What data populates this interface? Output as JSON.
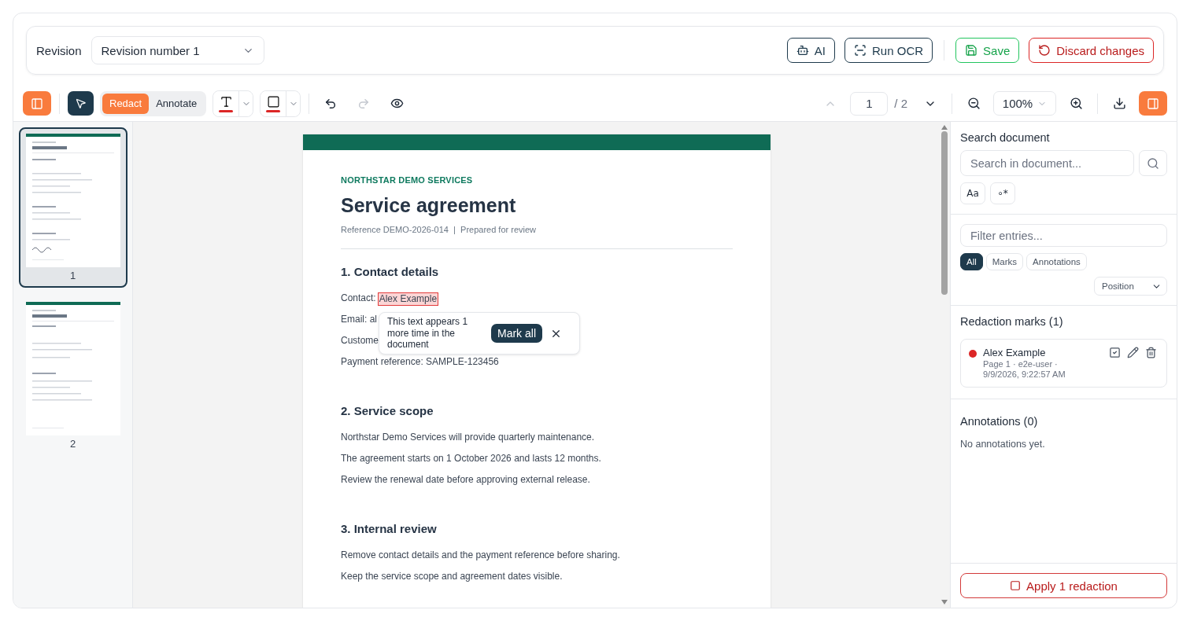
{
  "header": {
    "revision_label": "Revision",
    "revision_select": "Revision number 1",
    "buttons": [
      {
        "kind": "ai",
        "label": "AI"
      },
      {
        "kind": "ocr",
        "label": "Run OCR"
      },
      {
        "kind": "save",
        "label": "Save"
      },
      {
        "kind": "discard",
        "label": "Discard changes"
      }
    ]
  },
  "toolbar": {
    "mode_tabs": [
      {
        "label": "Redact",
        "selected": true
      },
      {
        "label": "Annotate",
        "selected": false
      }
    ],
    "tools": [
      {
        "kind": "text",
        "color": "#dc2626"
      },
      {
        "kind": "rect",
        "color": "#dc2626"
      }
    ],
    "history": [
      {
        "kind": "undo",
        "disabled": false
      },
      {
        "kind": "redo",
        "disabled": true
      }
    ],
    "page_input": "1",
    "page_total": "/ 2",
    "prev_disabled": true,
    "zoom": "100%"
  },
  "thumbnails": [
    {
      "label": "1",
      "selected": true
    },
    {
      "label": "2",
      "selected": false
    }
  ],
  "document": {
    "company": "NORTHSTAR DEMO SERVICES",
    "title": "Service agreement",
    "reference": "Reference DEMO-2026-014  |  Prepared for review",
    "sections": [
      {
        "heading": "1. Contact details",
        "lines": [
          {
            "text": "Contact:",
            "marked_text": "Alex Example"
          },
          {
            "text": "Email: al"
          },
          {
            "text": "Custome"
          },
          {
            "text": "Payment reference: SAMPLE-123456"
          }
        ]
      },
      {
        "heading": "2. Service scope",
        "lines": [
          {
            "text": "Northstar Demo Services will provide quarterly maintenance."
          },
          {
            "text": "The agreement starts on 1 October 2026 and lasts 12 months."
          },
          {
            "text": "Review the renewal date before approving external release."
          }
        ]
      },
      {
        "heading": "3. Internal review",
        "lines": [
          {
            "text": "Remove contact details and the payment reference before sharing."
          },
          {
            "text": "Keep the service scope and agreement dates visible."
          }
        ]
      }
    ]
  },
  "popover": {
    "text": "This text appears 1 more time in the document",
    "button": "Mark all"
  },
  "sidebar": {
    "search_title": "Search document",
    "search_placeholder": "Search in document...",
    "option_buttons": [
      "Aa",
      "∘*"
    ],
    "filter_placeholder": "Filter entries...",
    "filters": [
      {
        "label": "All",
        "selected": true
      },
      {
        "label": "Marks",
        "selected": false
      },
      {
        "label": "Annotations",
        "selected": false
      }
    ],
    "sort": "Position",
    "marks_title": "Redaction marks (1)",
    "marks": [
      {
        "name": "Alex Example",
        "meta": "Page 1 · e2e-user · 9/9/2026, 9:22:57 AM",
        "color": "#dc2626"
      }
    ],
    "annotations_title": "Annotations (0)",
    "annotations_empty": "No annotations yet.",
    "apply_button": "Apply 1 redaction"
  }
}
